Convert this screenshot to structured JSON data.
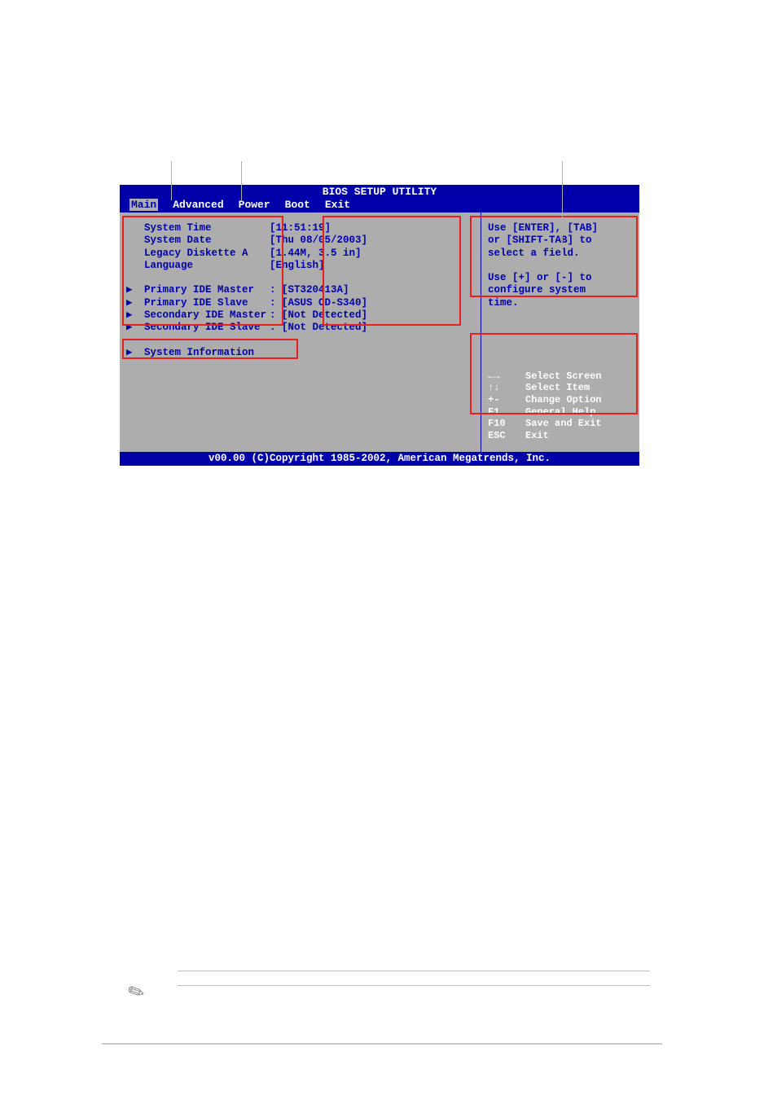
{
  "title": "BIOS SETUP UTILITY",
  "menu": {
    "items": [
      "Main",
      "Advanced",
      "Power",
      "Boot",
      "Exit"
    ],
    "selected": "Main"
  },
  "left_items": [
    {
      "arrow": false,
      "label": "System Time",
      "value": "[11:51:19]"
    },
    {
      "arrow": false,
      "label": "System Date",
      "value": "[Thu 08/05/2003]"
    },
    {
      "arrow": false,
      "label": "Legacy Diskette A",
      "value": "[1.44M, 3.5 in]"
    },
    {
      "arrow": false,
      "label": "Language",
      "value": "[English]"
    },
    {
      "arrow": null,
      "label": "",
      "value": ""
    },
    {
      "arrow": true,
      "label": "Primary IDE Master",
      "value": ": [ST320413A]"
    },
    {
      "arrow": true,
      "label": "Primary IDE Slave",
      "value": ": [ASUS CD-S340]"
    },
    {
      "arrow": true,
      "label": "Secondary IDE Master",
      "value": ": [Not Detected]"
    },
    {
      "arrow": true,
      "label": "Secondary IDE Slave",
      "value": ": [Not Detected]"
    },
    {
      "arrow": null,
      "label": "",
      "value": ""
    },
    {
      "arrow": true,
      "label": "System Information",
      "value": ""
    }
  ],
  "help_lines": [
    "Use [ENTER], [TAB]",
    "or [SHIFT-TAB] to",
    "select a field.",
    "",
    "Use [+] or [-] to",
    "configure system",
    "time."
  ],
  "keys": [
    {
      "k": "←→",
      "d": "Select Screen"
    },
    {
      "k": "↑↓",
      "d": "Select Item"
    },
    {
      "k": "+-",
      "d": "Change Option"
    },
    {
      "k": "F1",
      "d": "General Help"
    },
    {
      "k": "F10",
      "d": "Save and Exit"
    },
    {
      "k": "ESC",
      "d": "Exit"
    }
  ],
  "footer": "v00.00 (C)Copyright 1985-2002, American Megatrends, Inc."
}
